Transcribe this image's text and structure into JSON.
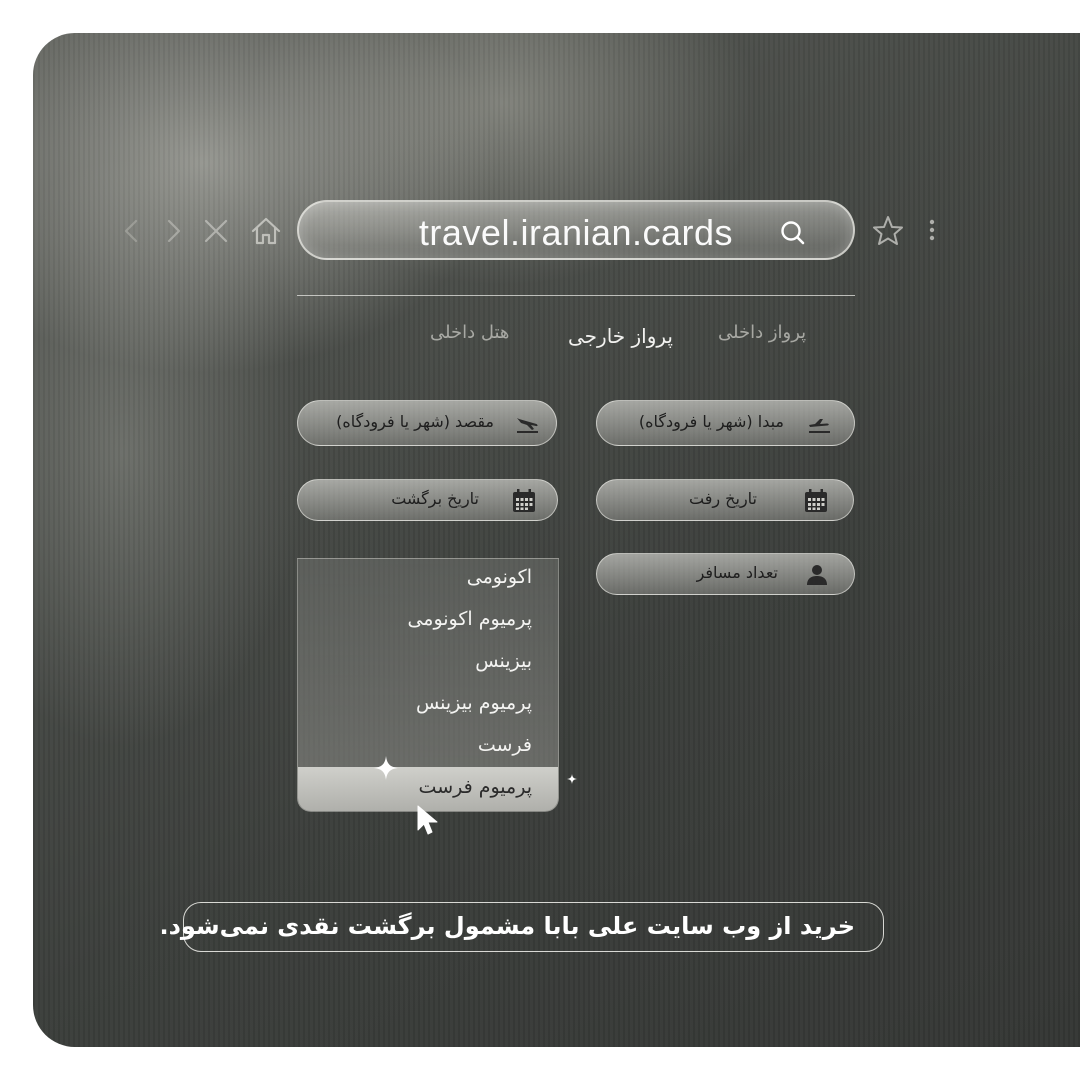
{
  "browser": {
    "url": "travel.iranian.cards"
  },
  "tabs": [
    {
      "label": "پرواز داخلی",
      "state": "inactive"
    },
    {
      "label": "پرواز خارجی",
      "state": "active"
    },
    {
      "label": "هتل داخلی",
      "state": "inactive"
    }
  ],
  "form": {
    "origin_placeholder": "مبدا (شهر یا فرودگاه)",
    "destination_placeholder": "مقصد (شهر یا فرودگاه)",
    "depart_date_placeholder": "تاریخ رفت",
    "return_date_placeholder": "تاریخ برگشت",
    "passengers_placeholder": "تعداد مسافر"
  },
  "cabin_class_dropdown": {
    "options": [
      "اکونومی",
      "پرمیوم اکونومی",
      "بیزینس",
      "پرمیوم بیزینس",
      "فرست",
      "پرمیوم فرست"
    ],
    "selected": "پرمیوم فرست"
  },
  "notice": "خرید از وب سایت علی بابا مشمول برگشت نقدی نمی‌شود.",
  "colors": {
    "page_background": "#ffffff",
    "card_dark": "#3b3e3b",
    "text_light": "#f4f4f2",
    "field_text": "#1e1e1e"
  }
}
